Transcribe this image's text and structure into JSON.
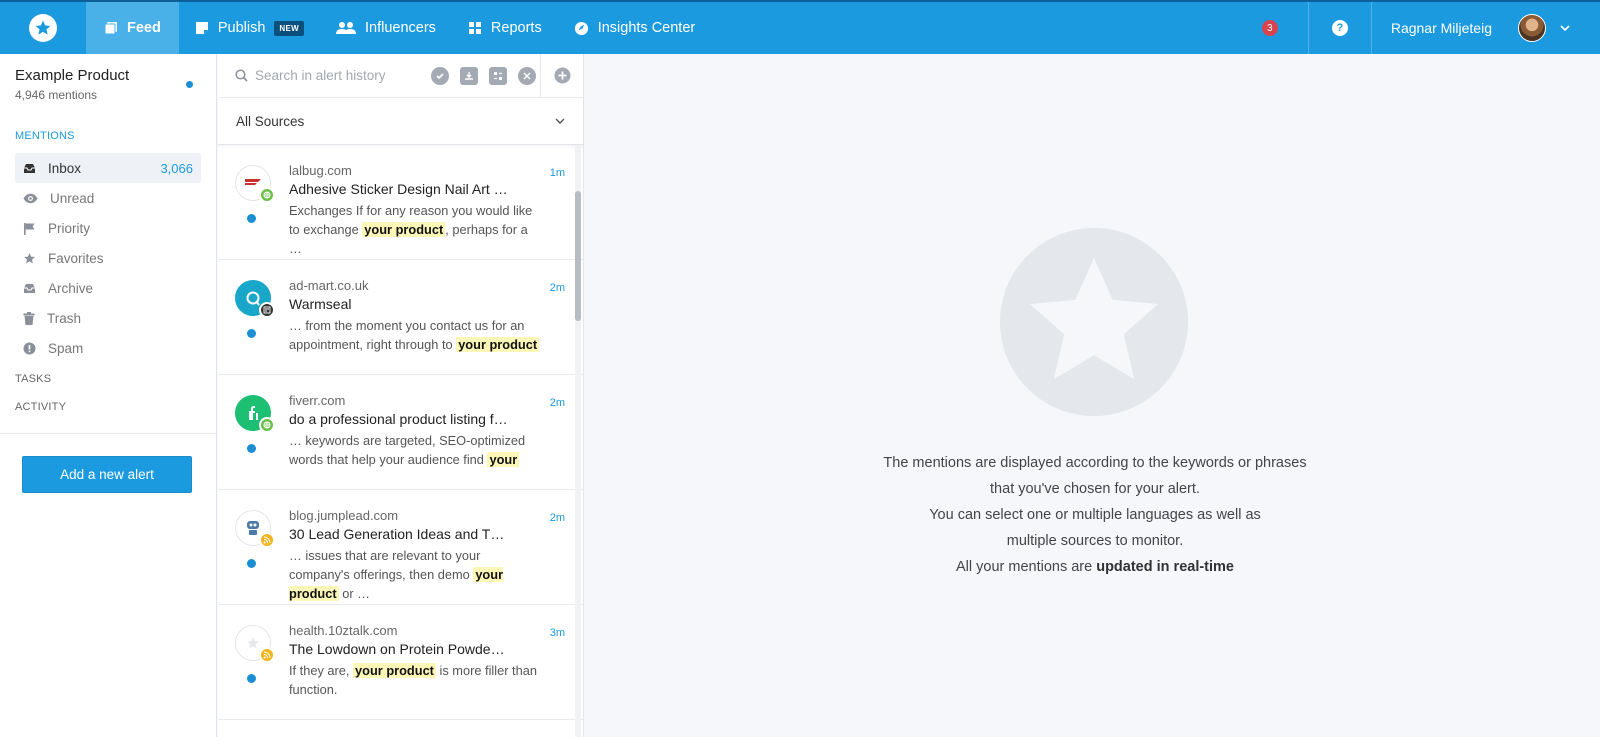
{
  "topbar": {
    "nav": [
      {
        "label": "Feed",
        "icon": "feed-icon",
        "active": true
      },
      {
        "label": "Publish",
        "icon": "publish-icon",
        "badge": "NEW"
      },
      {
        "label": "Influencers",
        "icon": "influencers-icon"
      },
      {
        "label": "Reports",
        "icon": "reports-icon"
      },
      {
        "label": "Insights Center",
        "icon": "insights-icon"
      }
    ],
    "notifications": "3",
    "help": "?",
    "user_name": "Ragnar Miljeteig",
    "colors": {
      "bar": "#1c9ae0",
      "active": "#4ab0e8",
      "badge": "#d9434e"
    }
  },
  "sidebar": {
    "product_name": "Example Product",
    "mentions_count": "4,946 mentions",
    "section_mentions": "MENTIONS",
    "items": [
      {
        "label": "Inbox",
        "count": "3,066",
        "icon": "inbox-icon"
      },
      {
        "label": "Unread",
        "icon": "eye-icon"
      },
      {
        "label": "Priority",
        "icon": "flag-icon"
      },
      {
        "label": "Favorites",
        "icon": "star-icon"
      },
      {
        "label": "Archive",
        "icon": "archive-icon"
      },
      {
        "label": "Trash",
        "icon": "trash-icon"
      },
      {
        "label": "Spam",
        "icon": "spam-icon"
      }
    ],
    "section_tasks": "TASKS",
    "section_activity": "ACTIVITY",
    "add_alert": "Add a new alert"
  },
  "list": {
    "search_placeholder": "Search in alert history",
    "sources": "All Sources",
    "items": [
      {
        "domain": "lalbug.com",
        "time": "1m",
        "title": "Adhesive Sticker Design Nail Art …",
        "pre": "Exchanges If for any reason you would like to exchange ",
        "hl": "your product",
        "post": ", perhaps for a …",
        "source": "web"
      },
      {
        "domain": "ad-mart.co.uk",
        "time": "2m",
        "title": "Warmseal",
        "pre": "… from the moment you contact us for an appointment, right through to ",
        "hl": "your product",
        "post": "",
        "source": "news"
      },
      {
        "domain": "fiverr.com",
        "time": "2m",
        "title": "do a professional product listing f…",
        "pre": "… keywords are targeted, SEO-optimized words that help your audience find ",
        "hl": "your",
        "post": "",
        "source": "web"
      },
      {
        "domain": "blog.jumplead.com",
        "time": "2m",
        "title": "30 Lead Generation Ideas and T…",
        "pre": "… issues that are relevant to your company's offerings, then demo ",
        "hl": "your product",
        "post": " or …",
        "source": "rss"
      },
      {
        "domain": "health.10ztalk.com",
        "time": "3m",
        "title": "The Lowdown on Protein Powde…",
        "pre": "If they are, ",
        "hl": "your product",
        "post": " is more filler than function.",
        "source": "rss"
      }
    ]
  },
  "empty_state": {
    "line1": "The mentions are displayed according to the keywords or phrases",
    "line2": "that you've chosen for your alert.",
    "line3": "You can select one or multiple languages as well as",
    "line4": "multiple sources to monitor.",
    "line5_pre": "All your mentions are ",
    "line5_bold": "updated in real-time"
  }
}
